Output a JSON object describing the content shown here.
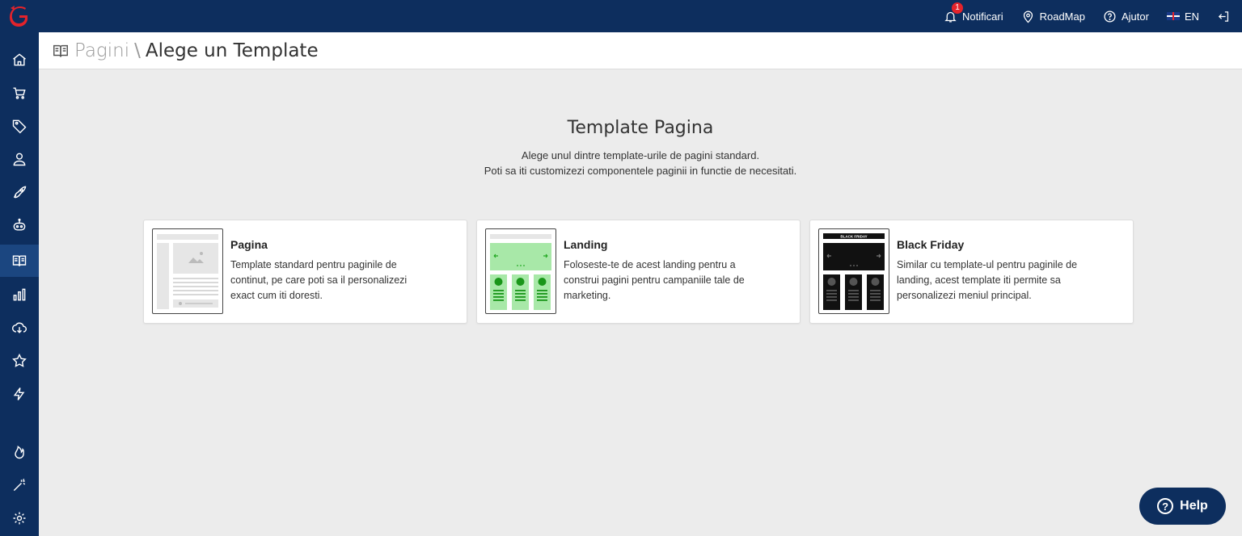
{
  "topbar": {
    "notifications_label": "Notificari",
    "notifications_count": "1",
    "roadmap_label": "RoadMap",
    "help_label": "Ajutor",
    "language_label": "EN"
  },
  "breadcrumb": {
    "parent": "Pagini",
    "separator": "\\",
    "current": "Alege un Template"
  },
  "intro": {
    "title": "Template Pagina",
    "line1": "Alege unul dintre template-urile de pagini standard.",
    "line2": "Poti sa iti customizezi componentele paginii in functie de necesitati."
  },
  "cards": [
    {
      "title": "Pagina",
      "desc": "Template standard pentru paginile de continut, pe care poti sa il personalizezi exact cum iti doresti."
    },
    {
      "title": "Landing",
      "desc": "Foloseste-te de acest landing pentru a construi pagini pentru campaniile tale de marketing."
    },
    {
      "title": "Black Friday",
      "desc": "Similar cu template-ul pentru paginile de landing, acest template iti permite sa personalizezi meniul principal.",
      "thumb_banner": "BLACK FRIDAY"
    }
  ],
  "help_button": {
    "label": "Help"
  },
  "colors": {
    "navy": "#0d2e5e",
    "accent_red": "#e3232b",
    "landing_green": "#22a822",
    "background": "#ececec"
  },
  "sidebar_icons": [
    "home-icon",
    "cart-icon",
    "tag-icon",
    "users-icon",
    "rocket-icon",
    "bot-icon",
    "book-icon",
    "chart-icon",
    "cloud-icon",
    "star-icon",
    "bolt-icon",
    "fire-icon",
    "magic-wand-icon",
    "settings-icon"
  ]
}
